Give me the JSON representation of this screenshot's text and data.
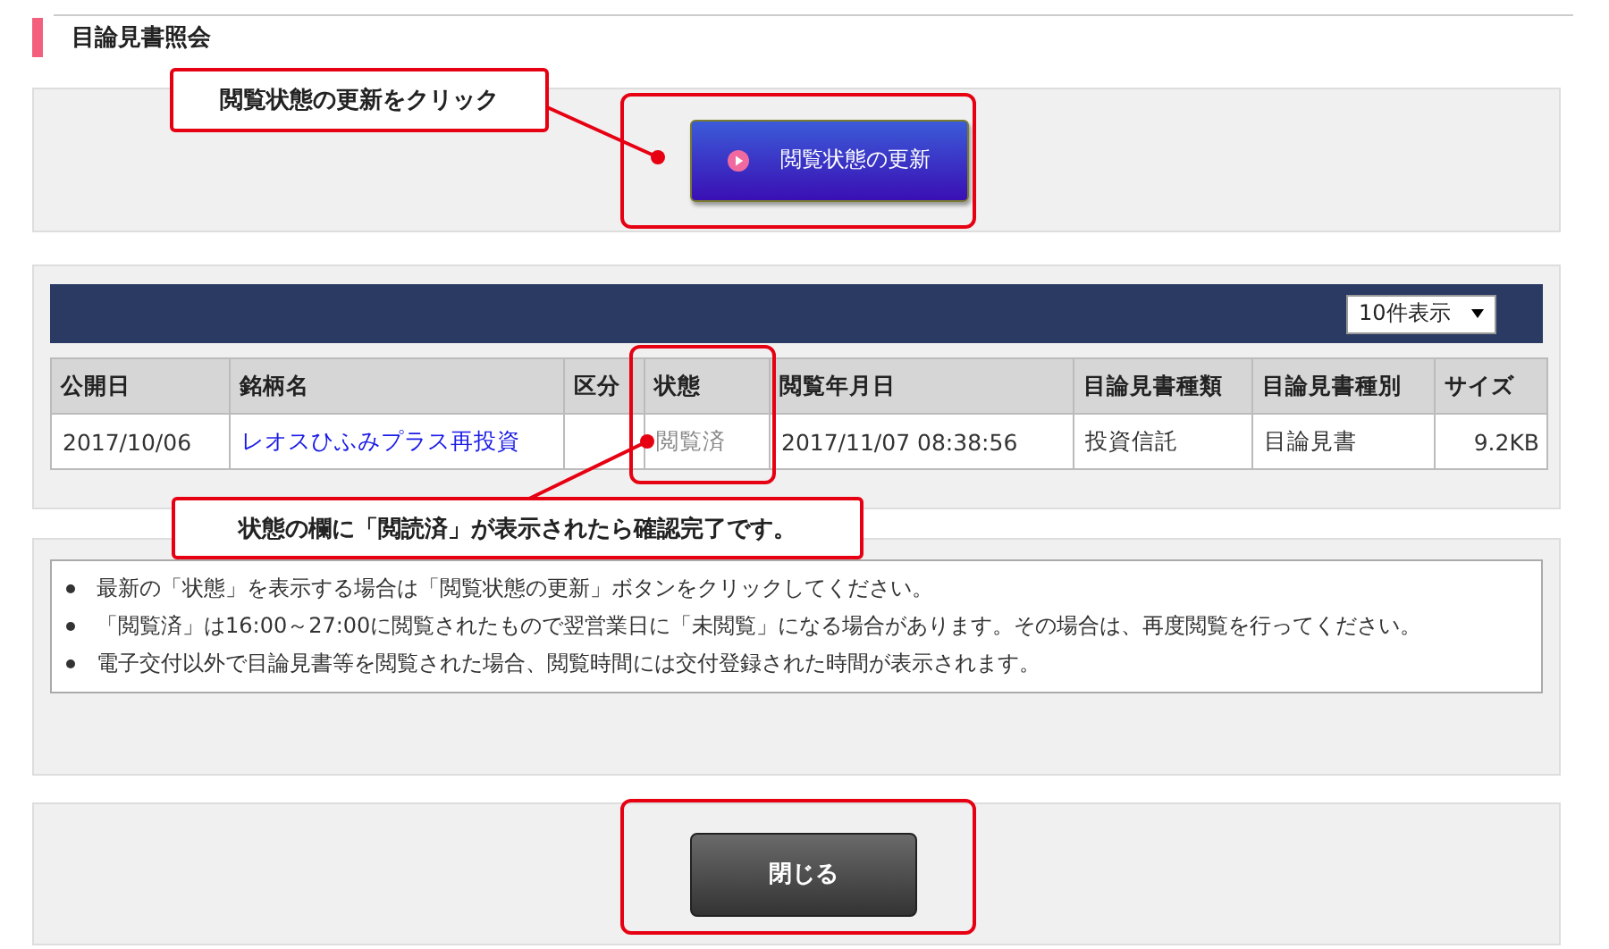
{
  "section_title": "目論見書照会",
  "update_button": {
    "label": "閲覧状態の更新"
  },
  "table": {
    "page_size_select": {
      "value": "10件表示"
    },
    "columns": [
      "公開日",
      "銘柄名",
      "区分",
      "状態",
      "閲覧年月日",
      "目論見書種類",
      "目論見書種別",
      "サイズ"
    ],
    "rows": [
      {
        "cells": [
          {
            "text": "2017/10/06",
            "kind": "text"
          },
          {
            "text": "レオスひふみプラス再投資",
            "kind": "link"
          },
          {
            "kind": "empty"
          },
          {
            "text": "閲覧済",
            "kind": "status"
          },
          {
            "text": "2017/11/07 08:38:56",
            "kind": "text"
          },
          {
            "text": "投資信託",
            "kind": "text"
          },
          {
            "text": "目論見書",
            "kind": "text"
          },
          {
            "text": "9.2KB",
            "kind": "number"
          }
        ]
      }
    ]
  },
  "notes": [
    "最新の「状態」を表示する場合は「閲覧状態の更新」ボタンをクリックしてください。",
    "「閲覧済」は16:00～27:00に閲覧されたもので翌営業日に「未閲覧」になる場合があります。その場合は、再度閲覧を行ってください。",
    "電子交付以外で目論見書等を閲覧された場合、閲覧時間には交付登録された時間が表示されます。"
  ],
  "close_button": {
    "label": "閉じる"
  },
  "callouts": [
    {
      "text": "閲覧状態の更新をクリック"
    },
    {
      "text": "状態の欄に「閲読済」が表示されたら確認完了です。"
    }
  ]
}
